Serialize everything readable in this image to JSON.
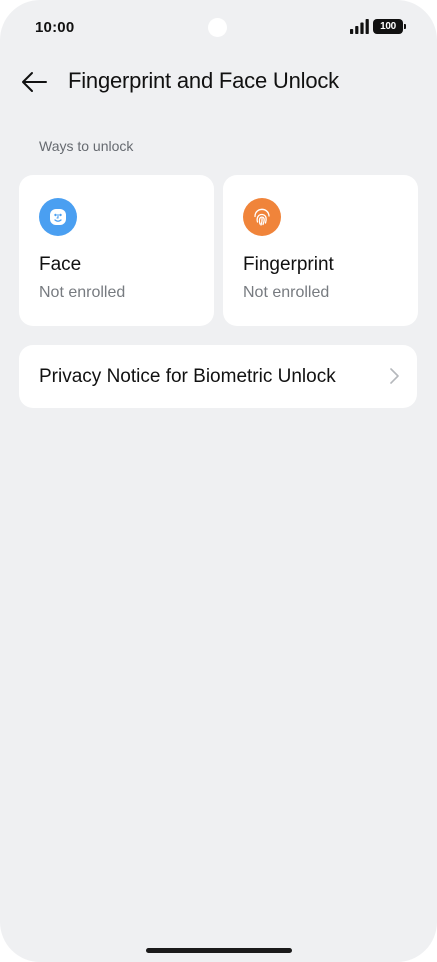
{
  "status_bar": {
    "time": "10:00",
    "battery": "100"
  },
  "header": {
    "title": "Fingerprint and Face Unlock"
  },
  "section": {
    "header": "Ways to unlock"
  },
  "cards": [
    {
      "title": "Face",
      "subtitle": "Not enrolled",
      "icon": "face-icon",
      "color": "#4a9ff1"
    },
    {
      "title": "Fingerprint",
      "subtitle": "Not enrolled",
      "icon": "fingerprint-icon",
      "color": "#f0843a"
    }
  ],
  "list": {
    "privacy_label": "Privacy Notice for Biometric Unlock"
  }
}
